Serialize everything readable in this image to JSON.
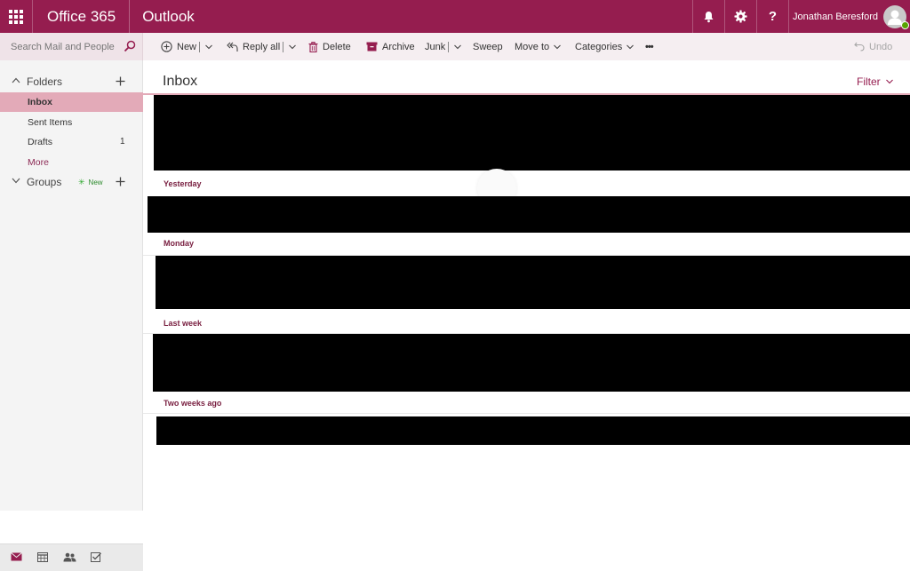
{
  "header": {
    "suite_name": "Office 365",
    "app_name": "Outlook",
    "user_name": "Jonathan Beresford",
    "icons": [
      "waffle-icon",
      "bell-icon",
      "gear-icon",
      "help-icon",
      "avatar-icon"
    ],
    "brand_color": "#951d4f"
  },
  "search": {
    "placeholder": "Search Mail and People"
  },
  "toolbar": {
    "new_label": "New",
    "reply_all_label": "Reply all",
    "delete_label": "Delete",
    "archive_label": "Archive",
    "junk_label": "Junk",
    "sweep_label": "Sweep",
    "move_to_label": "Move to",
    "categories_label": "Categories",
    "more_label": "•••",
    "undo_label": "Undo"
  },
  "folders": {
    "header_label": "Folders",
    "items": [
      {
        "label": "Inbox",
        "count": ""
      },
      {
        "label": "Sent Items",
        "count": ""
      },
      {
        "label": "Drafts",
        "count": "1"
      },
      {
        "label": "More",
        "count": ""
      }
    ]
  },
  "groups": {
    "header_label": "Groups",
    "new_badge": "New"
  },
  "list": {
    "title": "Inbox",
    "filter_label": "Filter",
    "group_headers": [
      "Yesterday",
      "Monday",
      "Last week",
      "Two weeks ago"
    ]
  },
  "colors": {
    "selected_folder": "#e3aab8",
    "group_header_text": "#7a2142",
    "accent": "#951d4f"
  }
}
